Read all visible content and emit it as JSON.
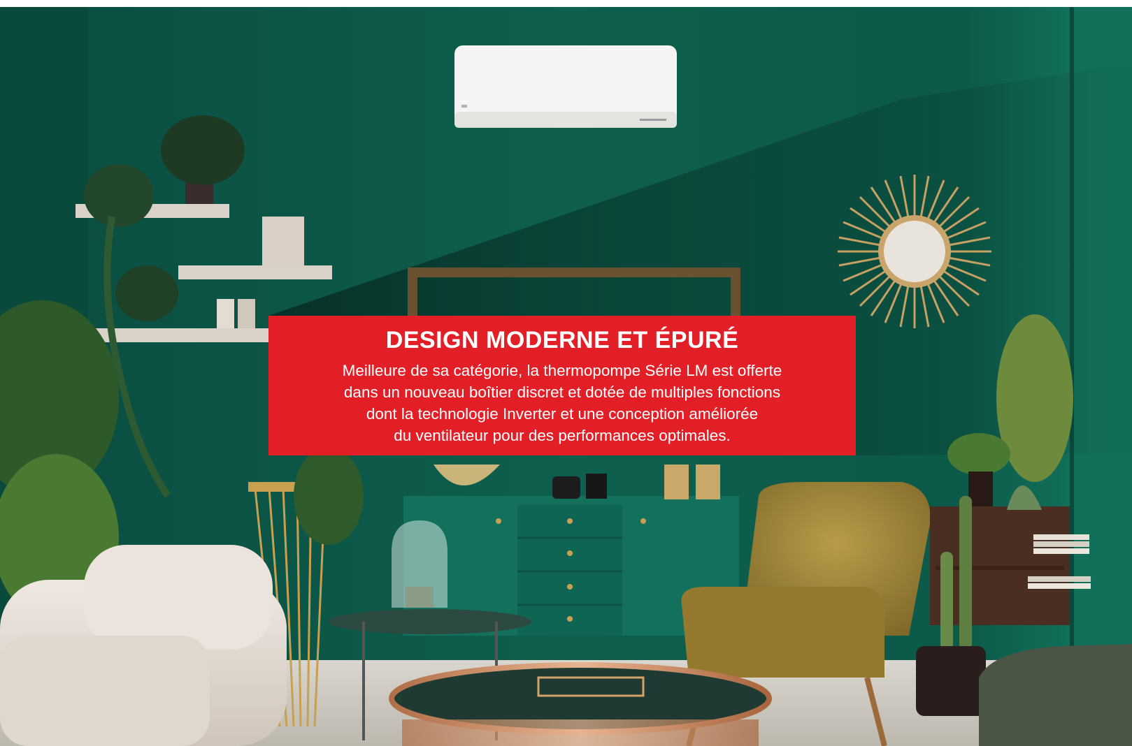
{
  "image": {
    "subject": "living-room-with-wall-mounted-heat-pump",
    "palette": {
      "wall": "#0b5a4a",
      "wall_dark": "#073f33",
      "accent_red": "#e21f26",
      "heat_pump": "#f4f4f2",
      "sofa": "#e8e0d8",
      "armchair": "#a88a3a",
      "gold": "#c8a050",
      "copper": "#c98b62"
    }
  },
  "callout": {
    "title": "DESIGN MODERNE ET ÉPURÉ",
    "lines": [
      "Meilleure de sa catégorie, la thermopompe Série LM est offerte",
      "dans un nouveau boîtier discret et dotée de multiples fonctions",
      "dont la technologie Inverter et une conception améliorée",
      "du ventilateur pour des performances optimales."
    ]
  }
}
